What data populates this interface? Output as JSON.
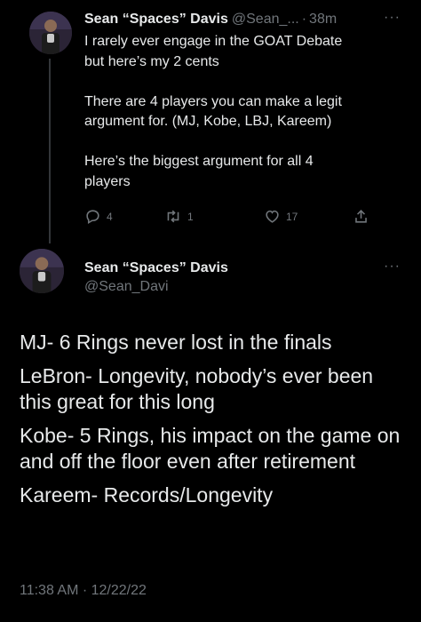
{
  "tweet1": {
    "display_name": "Sean “Spaces” Davis",
    "handle": "@Sean_...",
    "separator": "·",
    "time": "38m",
    "more": "···",
    "text": "I rarely ever engage in the GOAT Debate\nbut here’s my 2 cents\n\nThere are 4 players you can make a legit\nargument for. (MJ, Kobe, LBJ, Kareem)\n\nHere’s the biggest argument for all 4\nplayers",
    "actions": {
      "reply_count": "4",
      "retweet_count": "1",
      "like_count": "17"
    }
  },
  "tweet2": {
    "display_name": "Sean “Spaces” Davis",
    "handle": "@Sean_Davi",
    "more": "···",
    "paragraphs": [
      "MJ- 6 Rings never lost in the finals",
      "LeBron- Longevity, nobody’s ever been this great for this long",
      "Kobe- 5 Rings, his impact on the game on and off the floor even after retirement",
      "Kareem- Records/Longevity"
    ],
    "timestamp": "11:38 AM · 12/22/22"
  },
  "colors": {
    "background": "#000000",
    "text": "#e7e9ea",
    "muted": "#71767b",
    "thread_line": "#333639"
  },
  "icons": [
    "reply-icon",
    "retweet-icon",
    "like-icon",
    "share-icon",
    "more-icon",
    "avatar"
  ]
}
